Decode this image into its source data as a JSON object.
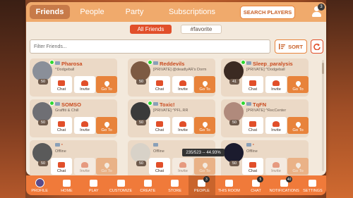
{
  "top_tabs": [
    {
      "label": "Friends",
      "active": true
    },
    {
      "label": "People",
      "active": false
    },
    {
      "label": "Party",
      "active": false
    },
    {
      "label": "Subscriptions",
      "active": false
    }
  ],
  "search_players_label": "SEARCH PLAYERS",
  "friend_requests_badge": "3",
  "filter_chips": [
    {
      "label": "All Friends",
      "active": true
    },
    {
      "label": "#favorite",
      "active": false
    }
  ],
  "filter": {
    "placeholder": "Filter Friends..."
  },
  "sort_label": "SORT",
  "action_labels": {
    "chat": "Chat",
    "invite": "Invite",
    "goto": "Go To"
  },
  "friends": [
    {
      "name": "Pharosa",
      "level": "50",
      "status": "^Dodgeball",
      "online": true,
      "can_goto": true
    },
    {
      "name": "Reddevils",
      "level": "50",
      "status": "[PRIVATE] @deadlyAR's Dorm",
      "online": true,
      "can_goto": true
    },
    {
      "name": "Sleep_paralysis",
      "level": "41",
      "status": "[PRIVATE] ^Dodgeball",
      "online": true,
      "can_goto": true
    },
    {
      "name": "SOMSO",
      "level": "50",
      "status": "Graffiti & Chill",
      "online": true,
      "can_goto": true
    },
    {
      "name": "Toxic!",
      "level": "50",
      "status": "[PRIVATE] ^PFL.RR",
      "online": true,
      "can_goto": true
    },
    {
      "name": "TqFN",
      "level": "50",
      "status": "[PRIVATE] ^RecCenter",
      "online": true,
      "can_goto": true
    },
    {
      "name": "'",
      "level": "50",
      "status": "Offline",
      "online": false,
      "can_goto": false
    },
    {
      "name": "",
      "level": "50",
      "status": "Offline",
      "online": false,
      "can_goto": false
    },
    {
      "name": "'",
      "level": "50",
      "status": "Offline",
      "online": false,
      "can_goto": false
    }
  ],
  "tooltip": "235/523 -- 44.93%",
  "nav": [
    {
      "label": "PROFILE",
      "badge": "",
      "active": false
    },
    {
      "label": "HOME",
      "badge": "",
      "active": false
    },
    {
      "label": "PLAY",
      "badge": "",
      "active": false
    },
    {
      "label": "CUSTOMIZE",
      "badge": "",
      "active": false
    },
    {
      "label": "CREATE",
      "badge": "",
      "active": false
    },
    {
      "label": "STORE",
      "badge": "",
      "active": false
    },
    {
      "label": "PEOPLE",
      "badge": "3",
      "active": true
    },
    {
      "label": "THIS ROOM",
      "badge": "",
      "active": false
    },
    {
      "label": "CHAT",
      "badge": "5",
      "active": false
    },
    {
      "label": "NOTIFICATIONS",
      "badge": "40",
      "active": false
    },
    {
      "label": "SETTINGS",
      "badge": "",
      "active": false
    }
  ],
  "colors": {
    "accent": "#e8833b",
    "tab_bar": "#f0aa6c",
    "active_chip": "#e14f2a",
    "panel": "#f3e9dc",
    "card": "#ebd9c6",
    "online": "#2fd82f"
  }
}
